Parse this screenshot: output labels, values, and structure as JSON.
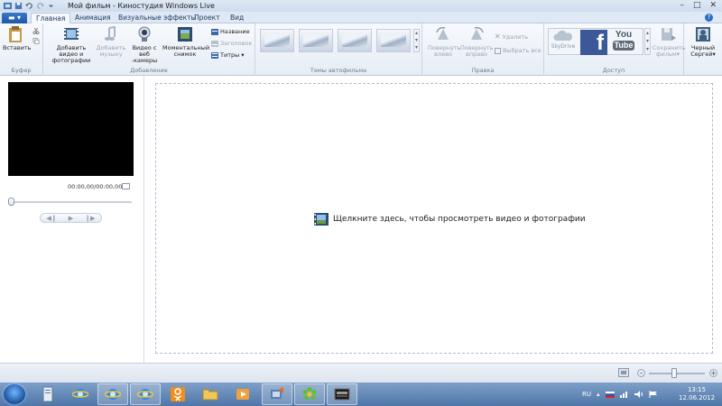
{
  "window": {
    "title": "Мой фильм - Киностудия Windows Live",
    "controls": {
      "minimize": "–",
      "maximize": "□",
      "close": "✕"
    }
  },
  "tabs": [
    {
      "label": "Главная",
      "active": true
    },
    {
      "label": "Анимация",
      "active": false
    },
    {
      "label": "Визуальные эффекты",
      "active": false
    },
    {
      "label": "Проект",
      "active": false
    },
    {
      "label": "Вид",
      "active": false
    }
  ],
  "ribbon": {
    "clipboard": {
      "paste": "Вставить",
      "group_label": "Буфер"
    },
    "add": {
      "add_video_photo": "Добавить видео и фотографии",
      "add_music": "Добавить музыку",
      "webcam_video": "Видео с веб -камеры",
      "snapshot": "Моментальный снимок",
      "title": "Название",
      "caption": "Заголовок",
      "credits": "Титры",
      "group_label": "Добавление"
    },
    "themes": {
      "group_label": "Темы автофильма"
    },
    "edit": {
      "rotate_left": "Повернуть влево",
      "rotate_right": "Повернуть вправо",
      "delete": "Удалить",
      "select_all": "Выбрать все",
      "group_label": "Правка"
    },
    "share": {
      "skydrive": "SkyDrive",
      "facebook": "f",
      "youtube_top": "You",
      "youtube_bottom": "Tube",
      "save_movie": "Сохранить фильм",
      "group_label": "Доступ"
    },
    "account": {
      "user": "Черный Сергей"
    }
  },
  "preview": {
    "timecode": "00:00,00/00:00,00"
  },
  "storyboard": {
    "message": "Щелкните здесь, чтобы просмотреть видео и фотографии"
  },
  "taskbar": {
    "language": "RU",
    "time": "13:15",
    "date": "12.06.2012"
  }
}
